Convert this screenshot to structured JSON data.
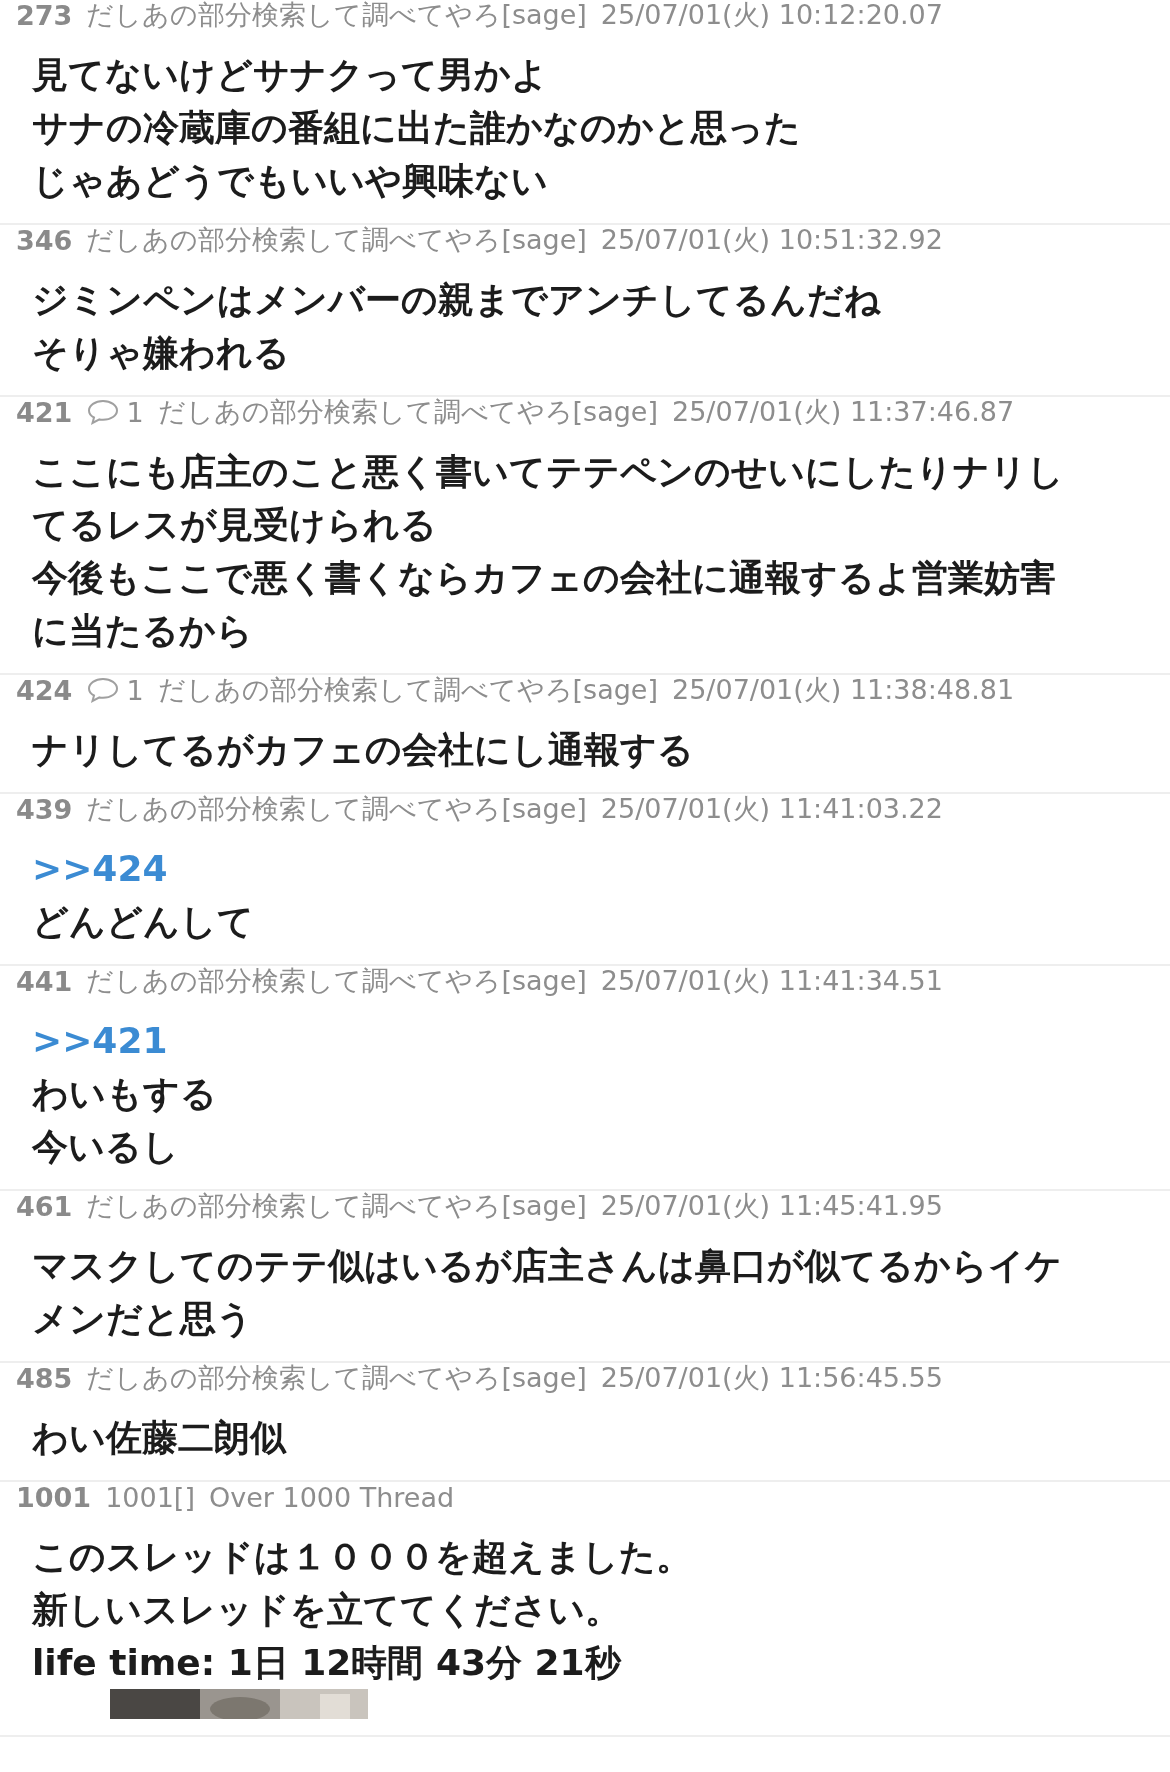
{
  "posts": [
    {
      "number": "273",
      "name": "だしあの部分検索して調べてやろ[sage]",
      "date": "25/07/01(火) 10:12:20.07",
      "lines": [
        {
          "kind": "text",
          "text": "見てないけどサナクって男かよ"
        },
        {
          "kind": "text",
          "text": "サナの冷蔵庫の番組に出た誰かなのかと思った"
        },
        {
          "kind": "text",
          "text": "じゃあどうでもいいや興味ない"
        }
      ]
    },
    {
      "number": "346",
      "name": "だしあの部分検索して調べてやろ[sage]",
      "date": "25/07/01(火) 10:51:32.92",
      "lines": [
        {
          "kind": "text",
          "text": "ジミンペンはメンバーの親までアンチしてるんだね"
        },
        {
          "kind": "text",
          "text": "そりゃ嫌われる"
        }
      ]
    },
    {
      "number": "421",
      "replies": "1",
      "name": "だしあの部分検索して調べてやろ[sage]",
      "date": "25/07/01(火) 11:37:46.87",
      "lines": [
        {
          "kind": "text",
          "text": "ここにも店主のこと悪く書いてテテペンのせいにしたりナリし"
        },
        {
          "kind": "text",
          "text": "てるレスが見受けられる"
        },
        {
          "kind": "text",
          "text": "今後もここで悪く書くならカフェの会社に通報するよ営業妨害"
        },
        {
          "kind": "text",
          "text": "に当たるから"
        }
      ]
    },
    {
      "number": "424",
      "replies": "1",
      "name": "だしあの部分検索して調べてやろ[sage]",
      "date": "25/07/01(火) 11:38:48.81",
      "lines": [
        {
          "kind": "text",
          "text": "ナリしてるがカフェの会社にし通報する"
        }
      ]
    },
    {
      "number": "439",
      "name": "だしあの部分検索して調べてやろ[sage]",
      "date": "25/07/01(火) 11:41:03.22",
      "lines": [
        {
          "kind": "anchor",
          "text": ">>424"
        },
        {
          "kind": "text",
          "text": "どんどんして"
        }
      ]
    },
    {
      "number": "441",
      "name": "だしあの部分検索して調べてやろ[sage]",
      "date": "25/07/01(火) 11:41:34.51",
      "lines": [
        {
          "kind": "anchor",
          "text": ">>421"
        },
        {
          "kind": "text",
          "text": "わいもする"
        },
        {
          "kind": "text",
          "text": "今いるし"
        }
      ]
    },
    {
      "number": "461",
      "name": "だしあの部分検索して調べてやろ[sage]",
      "date": "25/07/01(火) 11:45:41.95",
      "lines": [
        {
          "kind": "text",
          "text": "マスクしてのテテ似はいるが店主さんは鼻口が似てるからイケ"
        },
        {
          "kind": "text",
          "text": "メンだと思う"
        }
      ]
    },
    {
      "number": "485",
      "name": "だしあの部分検索して調べてやろ[sage]",
      "date": "25/07/01(火) 11:56:45.55",
      "lines": [
        {
          "kind": "text",
          "text": "わい佐藤二朗似"
        }
      ]
    },
    {
      "number": "1001",
      "name": "1001[]",
      "date": "Over 1000 Thread",
      "lines": [
        {
          "kind": "text",
          "text": "このスレッドは１０００を超えました。"
        },
        {
          "kind": "text",
          "text": "新しいスレッドを立ててください。"
        },
        {
          "kind": "text",
          "text": "life time: 1日 12時間 43分 21秒"
        },
        {
          "kind": "picture"
        }
      ]
    }
  ]
}
